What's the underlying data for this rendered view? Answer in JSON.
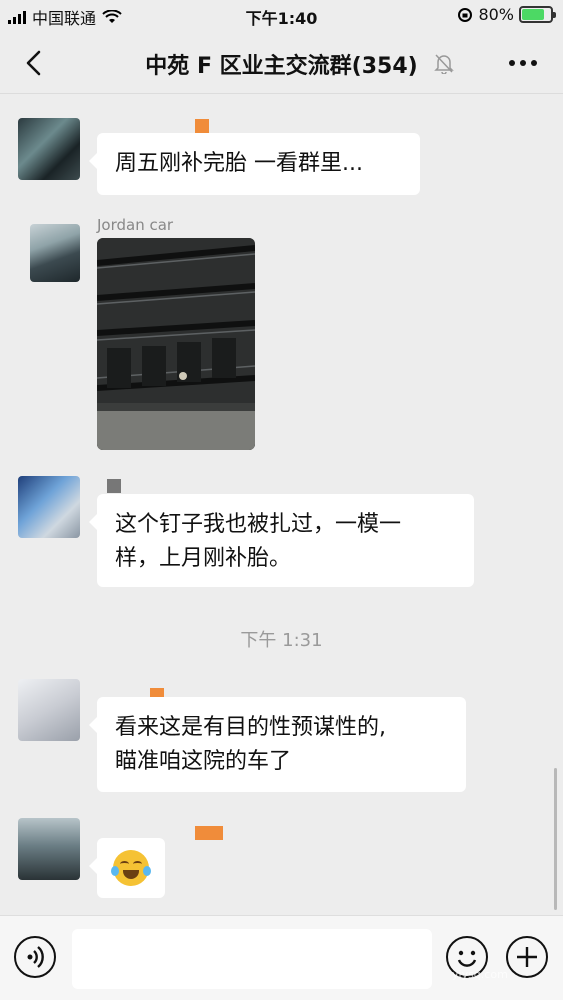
{
  "status_bar": {
    "carrier": "中国联通",
    "time": "下午1:40",
    "battery_percent": "80%",
    "battery_level": 0.8
  },
  "nav": {
    "title": "中苑 F 区业主交流群(354)"
  },
  "messages": [
    {
      "type": "text",
      "sender_nick": "",
      "text": "周五刚补完胎 一看群里..."
    },
    {
      "type": "image",
      "sender_nick": "Jordan car",
      "image_desc": "tire-with-nail-photo"
    },
    {
      "type": "text",
      "sender_nick": "",
      "line1": "这个钉子我也被扎过，一模一",
      "line2": "样，上月刚补胎。"
    },
    {
      "type": "text",
      "sender_nick": "",
      "line1": "看来这是有目的性预谋性的,",
      "line2": "瞄准咱这院的车了"
    },
    {
      "type": "emoji",
      "sender_nick": "",
      "emoji": "laughing-crying-face"
    }
  ],
  "timestamp": "下午 1:31",
  "input_bar": {
    "placeholder": ""
  },
  "watermark": "yiysq.com",
  "colors": {
    "bubble": "#ffffff",
    "background": "#ededed",
    "battery": "#4cd964"
  }
}
